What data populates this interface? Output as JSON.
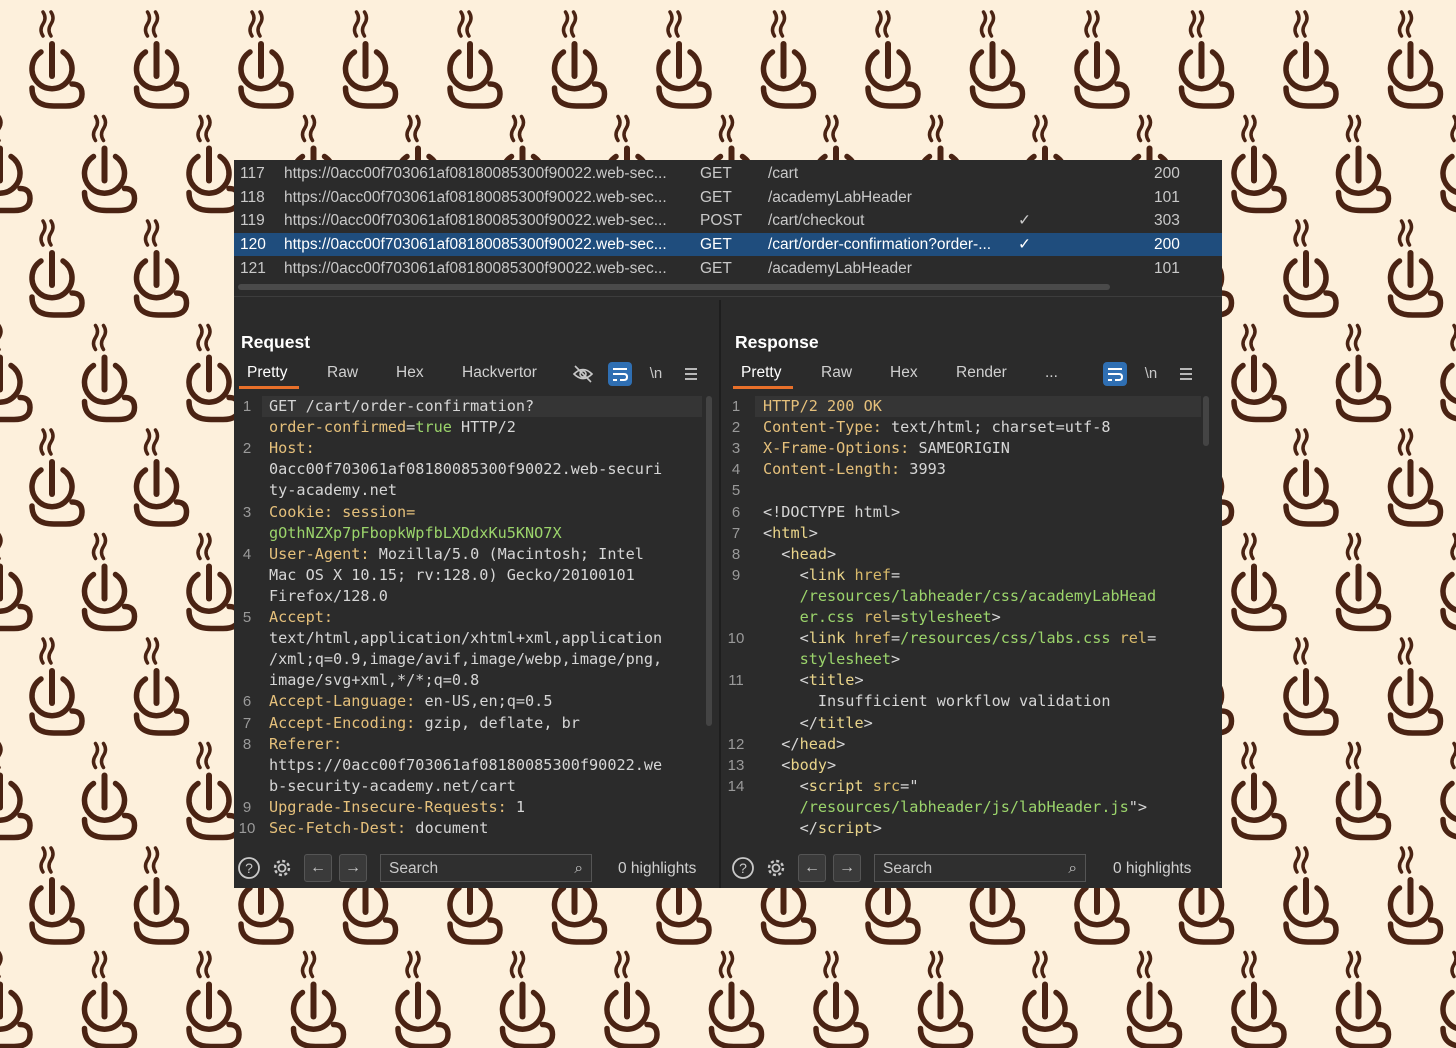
{
  "theme": {
    "background": "#fdf0dc",
    "pattern_color": "#4a2313",
    "pattern_icon": "steaming-coffee-cup-icon",
    "panel_bg": "#2b2b2b",
    "selection": "#1f4d7d",
    "accent_tab": "#e8702a",
    "toggle_on": "#2f6fb3"
  },
  "history": {
    "rows": [
      {
        "num": "117",
        "host": "https://0acc00f703061af08180085300f90022.web-sec...",
        "method": "GET",
        "path": "/cart",
        "check": "",
        "status": "200",
        "selected": false
      },
      {
        "num": "118",
        "host": "https://0acc00f703061af08180085300f90022.web-sec...",
        "method": "GET",
        "path": "/academyLabHeader",
        "check": "",
        "status": "101",
        "selected": false
      },
      {
        "num": "119",
        "host": "https://0acc00f703061af08180085300f90022.web-sec...",
        "method": "POST",
        "path": "/cart/checkout",
        "check": "✓",
        "status": "303",
        "selected": false
      },
      {
        "num": "120",
        "host": "https://0acc00f703061af08180085300f90022.web-sec...",
        "method": "GET",
        "path": "/cart/order-confirmation?order-...",
        "check": "✓",
        "status": "200",
        "selected": true
      },
      {
        "num": "121",
        "host": "https://0acc00f703061af08180085300f90022.web-sec...",
        "method": "GET",
        "path": "/academyLabHeader",
        "check": "",
        "status": "101",
        "selected": false
      }
    ]
  },
  "request": {
    "title": "Request",
    "tabs": [
      "Pretty",
      "Raw",
      "Hex",
      "Hackvertor"
    ],
    "active_tab": "Pretty",
    "icons": [
      "eye-off-icon",
      "wrap-lines-icon",
      "newline-icon",
      "menu-icon"
    ],
    "newline_label": "\\n",
    "lines": [
      {
        "num": "1",
        "parts": [
          {
            "t": "GET /cart/order-confirmation?",
            "c": ""
          }
        ]
      },
      {
        "num": "",
        "parts": [
          {
            "t": "order-confirmed",
            "c": "k"
          },
          {
            "t": "=",
            "c": ""
          },
          {
            "t": "true",
            "c": "v"
          },
          {
            "t": " HTTP/2",
            "c": ""
          }
        ]
      },
      {
        "num": "2",
        "parts": [
          {
            "t": "Host:",
            "c": "k"
          }
        ]
      },
      {
        "num": "",
        "parts": [
          {
            "t": "0acc00f703061af08180085300f90022.web-securi",
            "c": ""
          }
        ]
      },
      {
        "num": "",
        "parts": [
          {
            "t": "ty-academy.net",
            "c": ""
          }
        ]
      },
      {
        "num": "3",
        "parts": [
          {
            "t": "Cookie:",
            "c": "k"
          },
          {
            "t": " session=",
            "c": "k"
          }
        ]
      },
      {
        "num": "",
        "parts": [
          {
            "t": "gOthNZXp7pFbopkWpfbLXDdxKu5KNO7X",
            "c": "v"
          }
        ]
      },
      {
        "num": "4",
        "parts": [
          {
            "t": "User-Agent:",
            "c": "k"
          },
          {
            "t": " Mozilla/5.0 (Macintosh; Intel",
            "c": ""
          }
        ]
      },
      {
        "num": "",
        "parts": [
          {
            "t": "Mac OS X 10.15; rv:128.0) Gecko/20100101",
            "c": ""
          }
        ]
      },
      {
        "num": "",
        "parts": [
          {
            "t": "Firefox/128.0",
            "c": ""
          }
        ]
      },
      {
        "num": "5",
        "parts": [
          {
            "t": "Accept:",
            "c": "k"
          }
        ]
      },
      {
        "num": "",
        "parts": [
          {
            "t": "text/html,application/xhtml+xml,application",
            "c": ""
          }
        ]
      },
      {
        "num": "",
        "parts": [
          {
            "t": "/xml;q=0.9,image/avif,image/webp,image/png,",
            "c": ""
          }
        ]
      },
      {
        "num": "",
        "parts": [
          {
            "t": "image/svg+xml,*/*;q=0.8",
            "c": ""
          }
        ]
      },
      {
        "num": "6",
        "parts": [
          {
            "t": "Accept-Language:",
            "c": "k"
          },
          {
            "t": " en-US,en;q=0.5",
            "c": ""
          }
        ]
      },
      {
        "num": "7",
        "parts": [
          {
            "t": "Accept-Encoding:",
            "c": "k"
          },
          {
            "t": " gzip, deflate, br",
            "c": ""
          }
        ]
      },
      {
        "num": "8",
        "parts": [
          {
            "t": "Referer:",
            "c": "k"
          }
        ]
      },
      {
        "num": "",
        "parts": [
          {
            "t": "https://0acc00f703061af08180085300f90022.we",
            "c": ""
          }
        ]
      },
      {
        "num": "",
        "parts": [
          {
            "t": "b-security-academy.net/cart",
            "c": ""
          }
        ]
      },
      {
        "num": "9",
        "parts": [
          {
            "t": "Upgrade-Insecure-Requests:",
            "c": "k"
          },
          {
            "t": " 1",
            "c": ""
          }
        ]
      },
      {
        "num": "10",
        "parts": [
          {
            "t": "Sec-Fetch-Dest:",
            "c": "k"
          },
          {
            "t": " document",
            "c": ""
          }
        ]
      }
    ],
    "search_placeholder": "Search",
    "highlights": "0 highlights"
  },
  "response": {
    "title": "Response",
    "tabs": [
      "Pretty",
      "Raw",
      "Hex",
      "Render",
      "..."
    ],
    "active_tab": "Pretty",
    "icons": [
      "wrap-lines-icon",
      "newline-icon",
      "menu-icon"
    ],
    "newline_label": "\\n",
    "lines": [
      {
        "num": "1",
        "parts": [
          {
            "t": "HTTP/2 200 OK",
            "c": "k"
          }
        ]
      },
      {
        "num": "2",
        "parts": [
          {
            "t": "Content-Type:",
            "c": "k"
          },
          {
            "t": " text/html; charset=utf-8",
            "c": ""
          }
        ]
      },
      {
        "num": "3",
        "parts": [
          {
            "t": "X-Frame-Options:",
            "c": "k"
          },
          {
            "t": " SAMEORIGIN",
            "c": ""
          }
        ]
      },
      {
        "num": "4",
        "parts": [
          {
            "t": "Content-Length:",
            "c": "k"
          },
          {
            "t": " 3993",
            "c": ""
          }
        ]
      },
      {
        "num": "5",
        "parts": [
          {
            "t": "",
            "c": ""
          }
        ]
      },
      {
        "num": "6",
        "parts": [
          {
            "t": "<!DOCTYPE html>",
            "c": ""
          }
        ]
      },
      {
        "num": "7",
        "parts": [
          {
            "t": "<",
            "c": ""
          },
          {
            "t": "html",
            "c": "t"
          },
          {
            "t": ">",
            "c": ""
          }
        ]
      },
      {
        "num": "8",
        "parts": [
          {
            "t": "  <",
            "c": ""
          },
          {
            "t": "head",
            "c": "t"
          },
          {
            "t": ">",
            "c": ""
          }
        ]
      },
      {
        "num": "9",
        "parts": [
          {
            "t": "    <",
            "c": ""
          },
          {
            "t": "link",
            "c": "t"
          },
          {
            "t": " href",
            "c": "a"
          },
          {
            "t": "=",
            "c": ""
          }
        ]
      },
      {
        "num": "",
        "parts": [
          {
            "t": "    /resources/labheader/css/academyLabHead",
            "c": "v"
          }
        ]
      },
      {
        "num": "",
        "parts": [
          {
            "t": "    er.css",
            "c": "v"
          },
          {
            "t": " rel",
            "c": "a"
          },
          {
            "t": "=",
            "c": ""
          },
          {
            "t": "stylesheet",
            "c": "v"
          },
          {
            "t": ">",
            "c": ""
          }
        ]
      },
      {
        "num": "10",
        "parts": [
          {
            "t": "    <",
            "c": ""
          },
          {
            "t": "link",
            "c": "t"
          },
          {
            "t": " href",
            "c": "a"
          },
          {
            "t": "=",
            "c": ""
          },
          {
            "t": "/resources/css/labs.css",
            "c": "v"
          },
          {
            "t": " rel",
            "c": "a"
          },
          {
            "t": "=",
            "c": ""
          }
        ]
      },
      {
        "num": "",
        "parts": [
          {
            "t": "    stylesheet",
            "c": "v"
          },
          {
            "t": ">",
            "c": ""
          }
        ]
      },
      {
        "num": "11",
        "parts": [
          {
            "t": "    <",
            "c": ""
          },
          {
            "t": "title",
            "c": "t"
          },
          {
            "t": ">",
            "c": ""
          }
        ]
      },
      {
        "num": "",
        "parts": [
          {
            "t": "      Insufficient workflow validation",
            "c": ""
          }
        ]
      },
      {
        "num": "",
        "parts": [
          {
            "t": "    </",
            "c": ""
          },
          {
            "t": "title",
            "c": "t"
          },
          {
            "t": ">",
            "c": ""
          }
        ]
      },
      {
        "num": "12",
        "parts": [
          {
            "t": "  </",
            "c": ""
          },
          {
            "t": "head",
            "c": "t"
          },
          {
            "t": ">",
            "c": ""
          }
        ]
      },
      {
        "num": "13",
        "parts": [
          {
            "t": "  <",
            "c": ""
          },
          {
            "t": "body",
            "c": "t"
          },
          {
            "t": ">",
            "c": ""
          }
        ]
      },
      {
        "num": "14",
        "parts": [
          {
            "t": "    <",
            "c": ""
          },
          {
            "t": "script",
            "c": "t"
          },
          {
            "t": " src",
            "c": "a"
          },
          {
            "t": "=\"",
            "c": ""
          }
        ]
      },
      {
        "num": "",
        "parts": [
          {
            "t": "    /resources/labheader/js/labHeader.js",
            "c": "v"
          },
          {
            "t": "\">",
            "c": ""
          }
        ]
      },
      {
        "num": "",
        "parts": [
          {
            "t": "    </",
            "c": ""
          },
          {
            "t": "script",
            "c": "t"
          },
          {
            "t": ">",
            "c": ""
          }
        ]
      }
    ],
    "search_placeholder": "Search",
    "highlights": "0 highlights"
  }
}
